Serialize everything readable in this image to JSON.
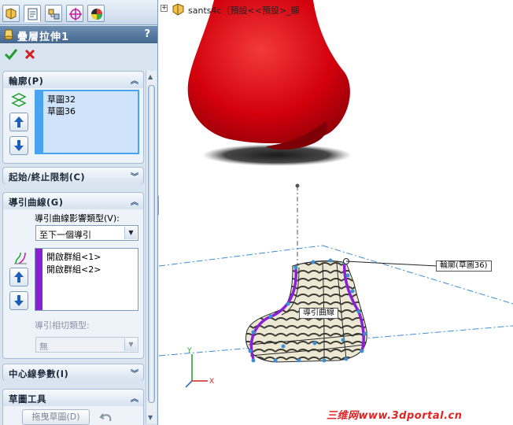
{
  "tabs": [
    {
      "icon": "feature-manager-icon",
      "active": false
    },
    {
      "icon": "property-manager-icon",
      "active": true
    },
    {
      "icon": "configuration-manager-icon",
      "active": false
    },
    {
      "icon": "dimxpert-icon",
      "active": false
    },
    {
      "icon": "display-manager-icon",
      "active": false
    }
  ],
  "property_manager": {
    "title": "疊層拉伸1",
    "help": "?",
    "ok_icon": "check-icon",
    "cancel_icon": "close-icon"
  },
  "profiles": {
    "header": "輪廓(P)",
    "items": [
      "草圖32",
      "草圖36"
    ]
  },
  "start_end": {
    "header": "起始/終止限制(C)"
  },
  "guide_curves": {
    "header": "導引曲線(G)",
    "influence_label": "導引曲線影響類型(V):",
    "influence_value": "至下一個導引",
    "items": [
      "開啟群組<1>",
      "開啟群組<2>"
    ],
    "tangency_label": "導引相切類型:",
    "tangency_value": "無"
  },
  "centerline": {
    "header": "中心線參數(I)"
  },
  "sketch_tools": {
    "header": "草圖工具",
    "drag_sketch_label": "拖曳草圖(D)"
  },
  "graphics": {
    "tree_label": "sants4c（預設<<預設>_顯",
    "callout_profile": "輪廓(草圖36)",
    "callout_guide": "導引曲線"
  },
  "watermark": "三维网www.3dportal.cn",
  "colors": {
    "red_body": "#d2000c",
    "guide_curve": "#8a1fd6",
    "profile_highlight": "#4aa3ee"
  }
}
